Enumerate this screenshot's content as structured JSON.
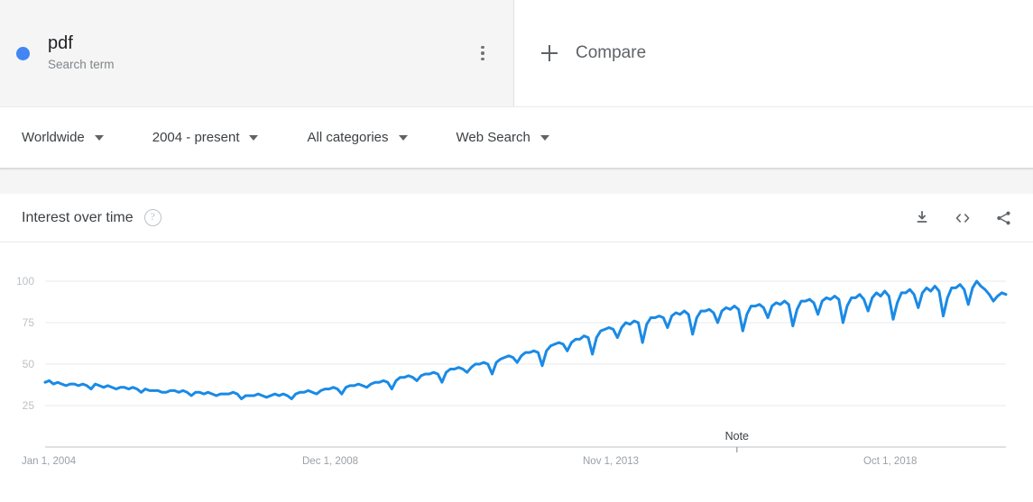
{
  "search_term": {
    "name": "pdf",
    "type_label": "Search term",
    "dot_color": "#4285f4",
    "menu_icon": "more-vert-icon"
  },
  "compare": {
    "label": "Compare",
    "icon": "plus-icon"
  },
  "filters": [
    {
      "label": "Worldwide",
      "icon": "chevron-down-icon"
    },
    {
      "label": "2004 - present",
      "icon": "chevron-down-icon"
    },
    {
      "label": "All categories",
      "icon": "chevron-down-icon"
    },
    {
      "label": "Web Search",
      "icon": "chevron-down-icon"
    }
  ],
  "chart_card": {
    "title": "Interest over time",
    "help_icon": "help-circle-icon",
    "actions": [
      {
        "name": "download-icon",
        "label": "Download CSV"
      },
      {
        "name": "embed-code-icon",
        "label": "Embed"
      },
      {
        "name": "share-icon",
        "label": "Share"
      }
    ]
  },
  "chart_data": {
    "type": "line",
    "title": "Interest over time",
    "xlabel": "",
    "ylabel": "",
    "ylim": [
      0,
      100
    ],
    "yticks": [
      25,
      50,
      75,
      100
    ],
    "xticks": [
      "Jan 1, 2004",
      "Dec 1, 2008",
      "Nov 1, 2013",
      "Oct 1, 2018"
    ],
    "grid": true,
    "legend": false,
    "line_color": "#1a8ae5",
    "line_width": 3,
    "annotations": [
      {
        "label": "Note",
        "x_fraction": 0.72
      }
    ],
    "series": [
      {
        "name": "pdf",
        "color": "#1a8ae5",
        "values": [
          39,
          40,
          38,
          39,
          38,
          37,
          38,
          38,
          37,
          38,
          37,
          35,
          38,
          37,
          36,
          37,
          36,
          35,
          36,
          36,
          35,
          36,
          35,
          33,
          35,
          34,
          34,
          34,
          33,
          33,
          34,
          34,
          33,
          34,
          33,
          31,
          33,
          33,
          32,
          33,
          32,
          31,
          32,
          32,
          32,
          33,
          32,
          29,
          31,
          31,
          31,
          32,
          31,
          30,
          31,
          32,
          31,
          32,
          31,
          29,
          32,
          33,
          33,
          34,
          33,
          32,
          34,
          35,
          35,
          36,
          35,
          32,
          36,
          37,
          37,
          38,
          37,
          36,
          38,
          39,
          39,
          40,
          39,
          35,
          40,
          42,
          42,
          43,
          42,
          40,
          43,
          44,
          44,
          45,
          44,
          39,
          45,
          47,
          47,
          48,
          47,
          45,
          48,
          50,
          50,
          51,
          50,
          44,
          51,
          53,
          54,
          55,
          54,
          51,
          55,
          57,
          57,
          58,
          57,
          49,
          58,
          61,
          62,
          63,
          62,
          58,
          63,
          65,
          65,
          67,
          66,
          56,
          66,
          70,
          71,
          72,
          71,
          66,
          72,
          75,
          74,
          76,
          75,
          63,
          74,
          78,
          78,
          79,
          78,
          72,
          79,
          81,
          80,
          82,
          80,
          68,
          78,
          82,
          82,
          83,
          81,
          75,
          82,
          84,
          83,
          85,
          83,
          70,
          80,
          85,
          85,
          86,
          84,
          78,
          85,
          87,
          86,
          88,
          86,
          73,
          83,
          88,
          88,
          89,
          87,
          80,
          88,
          90,
          89,
          91,
          89,
          75,
          85,
          90,
          90,
          92,
          89,
          82,
          90,
          93,
          91,
          94,
          91,
          77,
          87,
          93,
          93,
          95,
          92,
          84,
          93,
          96,
          94,
          97,
          94,
          79,
          90,
          96,
          96,
          98,
          95,
          86,
          96,
          100,
          97,
          95,
          92,
          88,
          91,
          93,
          92
        ]
      }
    ]
  }
}
